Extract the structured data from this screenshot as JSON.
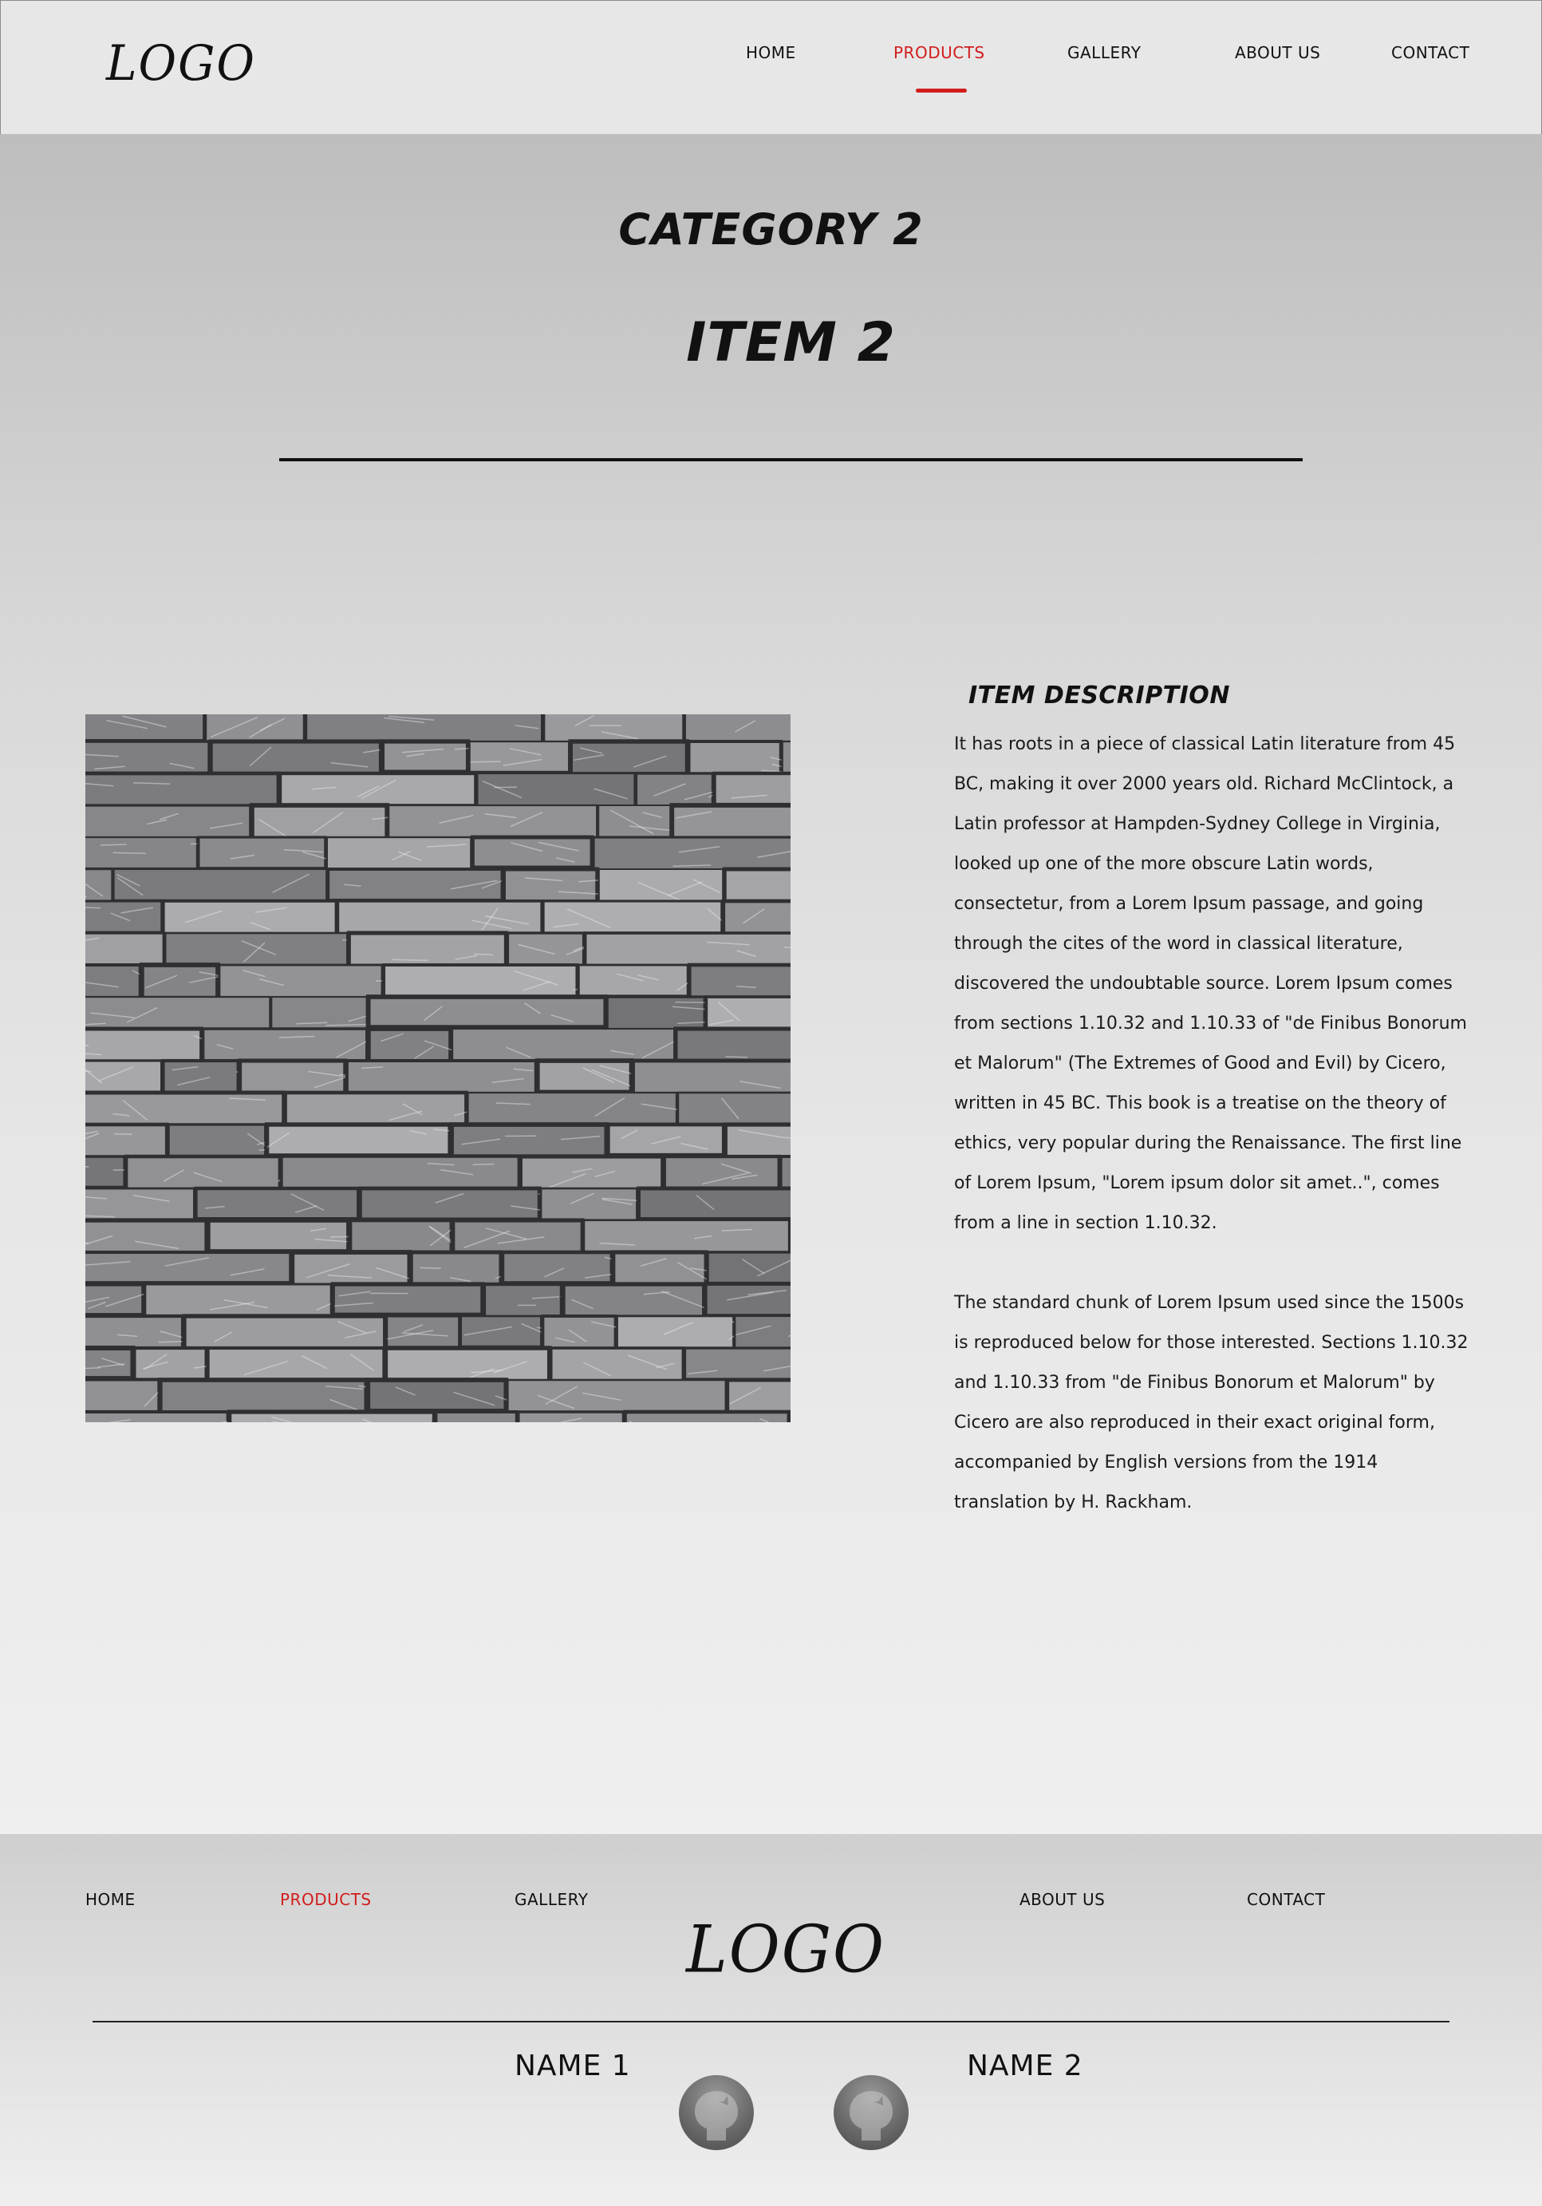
{
  "header": {
    "logo": "LOGO",
    "nav": {
      "home": "HOME",
      "products": "PRODUCTS",
      "gallery": "GALLERY",
      "about": "ABOUT US",
      "contact": "CONTACT"
    },
    "active_item": "products"
  },
  "main": {
    "category_title": "CATEGORY 2",
    "item_title": "ITEM 2",
    "image_icon": "stone-wall-image",
    "description": {
      "heading": "ITEM DESCRIPTION",
      "paragraph_1": "It has roots in a piece of classical Latin literature from 45 BC, making it over 2000 years old. Richard McClintock, a Latin professor at Hampden-Sydney College in Virginia, looked up one of the more obscure Latin words, consectetur, from a Lorem Ipsum passage, and going through the cites of the word in classical literature, discovered the undoubtable source. Lorem Ipsum comes from sections 1.10.32 and 1.10.33 of \"de Finibus Bonorum et Malorum\" (The Extremes of Good and Evil) by Cicero, written in 45 BC. This book is a treatise on the theory of ethics, very popular during the Renaissance. The first line of Lorem Ipsum, \"Lorem ipsum dolor sit amet..\", comes from a line in section 1.10.32.",
      "paragraph_2": "The standard chunk of Lorem Ipsum used since the 1500s is reproduced below for those interested. Sections 1.10.32 and 1.10.33 from \"de Finibus Bonorum et Malorum\" by Cicero are also reproduced in their exact original form, accompanied by English versions from the 1914 translation by H. Rackham."
    }
  },
  "footer": {
    "nav": {
      "home": "HOME",
      "products": "PRODUCTS",
      "gallery": "GALLERY",
      "about": "ABOUT US",
      "contact": "CONTACT"
    },
    "logo": "LOGO",
    "name_1": "NAME 1",
    "name_2": "NAME 2",
    "social_icon": "github-icon"
  },
  "colors": {
    "accent": "#d21d1d",
    "header_bg": "#e7e7e7",
    "text": "#111111"
  }
}
